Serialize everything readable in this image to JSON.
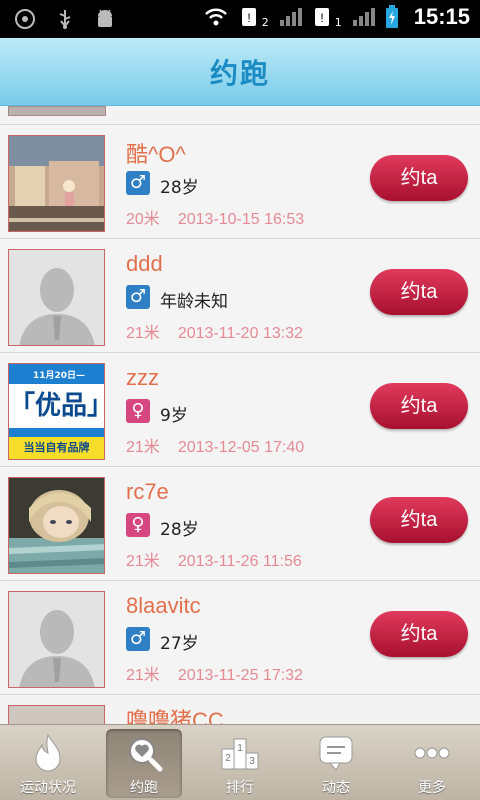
{
  "status_bar": {
    "time": "15:15",
    "sim1_label": "2",
    "sim2_label": "1"
  },
  "header": {
    "title": "约跑"
  },
  "users": [
    {
      "name": "酷^O^",
      "gender": "male",
      "gender_symbol": "♂",
      "age": "28岁",
      "distance": "20米",
      "time": "2013-10-15 16:53",
      "action": "约ta",
      "avatar": "street-photo"
    },
    {
      "name": "ddd",
      "gender": "male",
      "gender_symbol": "♂",
      "age": "年龄未知",
      "distance": "21米",
      "time": "2013-11-20 13:32",
      "action": "约ta",
      "avatar": "default-avatar"
    },
    {
      "name": "zzz",
      "gender": "female",
      "gender_symbol": "♀",
      "age": "9岁",
      "distance": "21米",
      "time": "2013-12-05 17:40",
      "action": "约ta",
      "avatar": "promo-image",
      "avatar_text": {
        "line1": "11月20日—",
        "main": "「优品」",
        "bottom": "当当自有品牌"
      }
    },
    {
      "name": "rc7e",
      "gender": "female",
      "gender_symbol": "♀",
      "age": "28岁",
      "distance": "21米",
      "time": "2013-11-26 11:56",
      "action": "约ta",
      "avatar": "girl-photo"
    },
    {
      "name": "8laavitc",
      "gender": "male",
      "gender_symbol": "♂",
      "age": "27岁",
      "distance": "21米",
      "time": "2013-11-25 17:32",
      "action": "约ta",
      "avatar": "default-avatar"
    }
  ],
  "partial_user": {
    "name": "噜噜猪CC"
  },
  "tabs": [
    {
      "label": "运动状况",
      "icon": "flame-icon",
      "active": false
    },
    {
      "label": "约跑",
      "icon": "heart-search-icon",
      "active": true
    },
    {
      "label": "排行",
      "icon": "podium-icon",
      "active": false
    },
    {
      "label": "动态",
      "icon": "chat-icon",
      "active": false
    },
    {
      "label": "更多",
      "icon": "more-dots-icon",
      "active": false
    }
  ],
  "colors": {
    "title": "#1a8bc3",
    "name": "#e2704d",
    "meta": "#e58a95",
    "button": "#c0203f",
    "male": "#2f7fc5",
    "female": "#d6477f"
  }
}
